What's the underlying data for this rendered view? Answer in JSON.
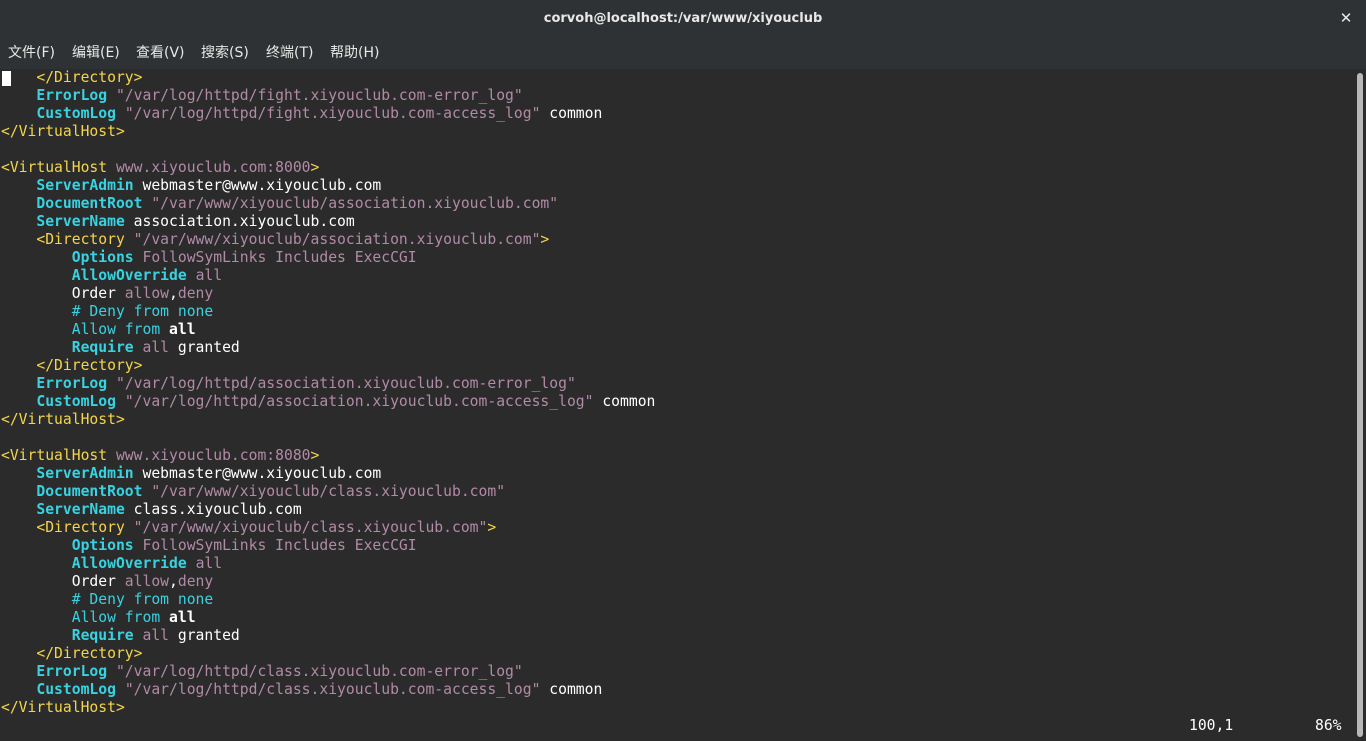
{
  "window": {
    "title": "corvoh@localhost:/var/www/xiyouclub",
    "close_label": "✕"
  },
  "menu": {
    "items": [
      {
        "label": "文件(F)"
      },
      {
        "label": "编辑(E)"
      },
      {
        "label": "查看(V)"
      },
      {
        "label": "搜索(S)"
      },
      {
        "label": "终端(T)"
      },
      {
        "label": "帮助(H)"
      }
    ]
  },
  "colors": {
    "background": "#2b2b2b",
    "tag": "#f3d54a",
    "string": "#b28aa6",
    "keyword": "#38d2e0",
    "text": "#ffffff"
  },
  "editor": {
    "lines": [
      [
        [
          "tag",
          "    </Directory>"
        ]
      ],
      [
        [
          "plain",
          "    "
        ],
        [
          "kw",
          "ErrorLog"
        ],
        [
          "plain",
          " "
        ],
        [
          "str",
          "\"/var/log/httpd/fight.xiyouclub.com-error_log\""
        ]
      ],
      [
        [
          "plain",
          "    "
        ],
        [
          "kw",
          "CustomLog"
        ],
        [
          "plain",
          " "
        ],
        [
          "str",
          "\"/var/log/httpd/fight.xiyouclub.com-access_log\""
        ],
        [
          "plain",
          " common"
        ]
      ],
      [
        [
          "tag",
          "</VirtualHost>"
        ]
      ],
      [
        [
          "plain",
          ""
        ]
      ],
      [
        [
          "tag",
          "<VirtualHost"
        ],
        [
          "attr",
          " www.xiyouclub.com:8000"
        ],
        [
          "tag",
          ">"
        ]
      ],
      [
        [
          "plain",
          "    "
        ],
        [
          "kw",
          "ServerAdmin"
        ],
        [
          "plain",
          " webmaster@www.xiyouclub.com"
        ]
      ],
      [
        [
          "plain",
          "    "
        ],
        [
          "kw",
          "DocumentRoot"
        ],
        [
          "plain",
          " "
        ],
        [
          "str",
          "\"/var/www/xiyouclub/association.xiyouclub.com\""
        ]
      ],
      [
        [
          "plain",
          "    "
        ],
        [
          "kw",
          "ServerName"
        ],
        [
          "plain",
          " association.xiyouclub.com"
        ]
      ],
      [
        [
          "plain",
          "    "
        ],
        [
          "tag",
          "<Directory"
        ],
        [
          "attr",
          " \"/var/www/xiyouclub/association.xiyouclub.com\""
        ],
        [
          "tag",
          ">"
        ]
      ],
      [
        [
          "plain",
          "        "
        ],
        [
          "kw",
          "Options"
        ],
        [
          "plain",
          " "
        ],
        [
          "str",
          "FollowSymLinks Includes ExecCGI"
        ]
      ],
      [
        [
          "plain",
          "        "
        ],
        [
          "kw",
          "AllowOverride"
        ],
        [
          "plain",
          " "
        ],
        [
          "str",
          "all"
        ]
      ],
      [
        [
          "plain",
          "        Order "
        ],
        [
          "str",
          "allow"
        ],
        [
          "plain",
          ","
        ],
        [
          "str",
          "deny"
        ]
      ],
      [
        [
          "plain",
          "        "
        ],
        [
          "kwp",
          "# Deny from none"
        ]
      ],
      [
        [
          "plain",
          "        "
        ],
        [
          "kwp",
          "Allow from"
        ],
        [
          "plain",
          " "
        ],
        [
          "wb",
          "all"
        ]
      ],
      [
        [
          "plain",
          "        "
        ],
        [
          "kw",
          "Require"
        ],
        [
          "plain",
          " "
        ],
        [
          "str",
          "all"
        ],
        [
          "plain",
          " granted"
        ]
      ],
      [
        [
          "plain",
          "    "
        ],
        [
          "tag",
          "</Directory>"
        ]
      ],
      [
        [
          "plain",
          "    "
        ],
        [
          "kw",
          "ErrorLog"
        ],
        [
          "plain",
          " "
        ],
        [
          "str",
          "\"/var/log/httpd/association.xiyouclub.com-error_log\""
        ]
      ],
      [
        [
          "plain",
          "    "
        ],
        [
          "kw",
          "CustomLog"
        ],
        [
          "plain",
          " "
        ],
        [
          "str",
          "\"/var/log/httpd/association.xiyouclub.com-access_log\""
        ],
        [
          "plain",
          " common"
        ]
      ],
      [
        [
          "tag",
          "</VirtualHost>"
        ]
      ],
      [
        [
          "plain",
          ""
        ]
      ],
      [
        [
          "tag",
          "<VirtualHost"
        ],
        [
          "attr",
          " www.xiyouclub.com:8080"
        ],
        [
          "tag",
          ">"
        ]
      ],
      [
        [
          "plain",
          "    "
        ],
        [
          "kw",
          "ServerAdmin"
        ],
        [
          "plain",
          " webmaster@www.xiyouclub.com"
        ]
      ],
      [
        [
          "plain",
          "    "
        ],
        [
          "kw",
          "DocumentRoot"
        ],
        [
          "plain",
          " "
        ],
        [
          "str",
          "\"/var/www/xiyouclub/class.xiyouclub.com\""
        ]
      ],
      [
        [
          "plain",
          "    "
        ],
        [
          "kw",
          "ServerName"
        ],
        [
          "plain",
          " class.xiyouclub.com"
        ]
      ],
      [
        [
          "plain",
          "    "
        ],
        [
          "tag",
          "<Directory"
        ],
        [
          "attr",
          " \"/var/www/xiyouclub/class.xiyouclub.com\""
        ],
        [
          "tag",
          ">"
        ]
      ],
      [
        [
          "plain",
          "        "
        ],
        [
          "kw",
          "Options"
        ],
        [
          "plain",
          " "
        ],
        [
          "str",
          "FollowSymLinks Includes ExecCGI"
        ]
      ],
      [
        [
          "plain",
          "        "
        ],
        [
          "kw",
          "AllowOverride"
        ],
        [
          "plain",
          " "
        ],
        [
          "str",
          "all"
        ]
      ],
      [
        [
          "plain",
          "        Order "
        ],
        [
          "str",
          "allow"
        ],
        [
          "plain",
          ","
        ],
        [
          "str",
          "deny"
        ]
      ],
      [
        [
          "plain",
          "        "
        ],
        [
          "kwp",
          "# Deny from none"
        ]
      ],
      [
        [
          "plain",
          "        "
        ],
        [
          "kwp",
          "Allow from"
        ],
        [
          "plain",
          " "
        ],
        [
          "wb",
          "all"
        ]
      ],
      [
        [
          "plain",
          "        "
        ],
        [
          "kw",
          "Require"
        ],
        [
          "plain",
          " "
        ],
        [
          "str",
          "all"
        ],
        [
          "plain",
          " granted"
        ]
      ],
      [
        [
          "plain",
          "    "
        ],
        [
          "tag",
          "</Directory>"
        ]
      ],
      [
        [
          "plain",
          "    "
        ],
        [
          "kw",
          "ErrorLog"
        ],
        [
          "plain",
          " "
        ],
        [
          "str",
          "\"/var/log/httpd/class.xiyouclub.com-error_log\""
        ]
      ],
      [
        [
          "plain",
          "    "
        ],
        [
          "kw",
          "CustomLog"
        ],
        [
          "plain",
          " "
        ],
        [
          "str",
          "\"/var/log/httpd/class.xiyouclub.com-access_log\""
        ],
        [
          "plain",
          " common"
        ]
      ],
      [
        [
          "tag",
          "</VirtualHost>"
        ]
      ]
    ]
  },
  "status": {
    "position": "100,1",
    "percent": "86%"
  }
}
